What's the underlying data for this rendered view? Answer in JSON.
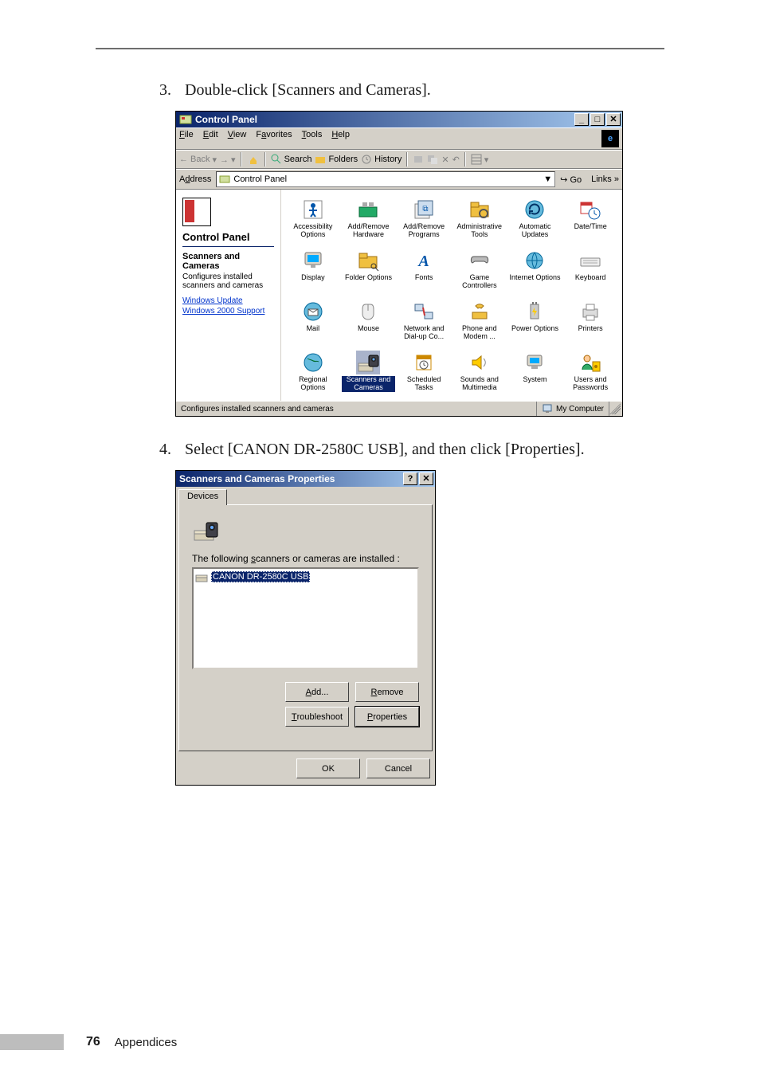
{
  "steps": {
    "s3": {
      "num": "3.",
      "text": "Double-click [Scanners and Cameras]."
    },
    "s4": {
      "num": "4.",
      "text": "Select [CANON DR-2580C USB], and then click [Properties]."
    }
  },
  "control_panel_window": {
    "title": "Control Panel",
    "menus": {
      "file": "File",
      "edit": "Edit",
      "view": "View",
      "favorites": "Favorites",
      "tools": "Tools",
      "help": "Help"
    },
    "toolbar": {
      "back": "Back",
      "search": "Search",
      "folders": "Folders",
      "history": "History"
    },
    "address": {
      "label": "Address",
      "value": "Control Panel",
      "go": "Go",
      "links": "Links"
    },
    "left": {
      "title": "Control Panel",
      "subtitle": "Scanners and Cameras",
      "description": "Configures installed scanners and cameras",
      "links": {
        "wu": "Windows Update",
        "w2k": "Windows 2000 Support"
      }
    },
    "items": [
      {
        "label": "Accessibility Options"
      },
      {
        "label": "Add/Remove Hardware"
      },
      {
        "label": "Add/Remove Programs"
      },
      {
        "label": "Administrative Tools"
      },
      {
        "label": "Automatic Updates"
      },
      {
        "label": "Date/Time"
      },
      {
        "label": "Display"
      },
      {
        "label": "Folder Options"
      },
      {
        "label": "Fonts"
      },
      {
        "label": "Game Controllers"
      },
      {
        "label": "Internet Options"
      },
      {
        "label": "Keyboard"
      },
      {
        "label": "Mail"
      },
      {
        "label": "Mouse"
      },
      {
        "label": "Network and Dial-up Co..."
      },
      {
        "label": "Phone and Modem ..."
      },
      {
        "label": "Power Options"
      },
      {
        "label": "Printers"
      },
      {
        "label": "Regional Options"
      },
      {
        "label": "Scanners and Cameras",
        "selected": true
      },
      {
        "label": "Scheduled Tasks"
      },
      {
        "label": "Sounds and Multimedia"
      },
      {
        "label": "System"
      },
      {
        "label": "Users and Passwords"
      }
    ],
    "statusbar": {
      "text": "Configures installed scanners and cameras",
      "location": "My Computer"
    }
  },
  "properties_dialog": {
    "title": "Scanners and Cameras Properties",
    "tab": "Devices",
    "intro": "The following scanners or cameras are installed :",
    "list_item": "CANON DR-2580C USB",
    "buttons": {
      "add": "Add...",
      "remove": "Remove",
      "troubleshoot": "Troubleshoot",
      "properties": "Properties",
      "ok": "OK",
      "cancel": "Cancel"
    }
  },
  "footer": {
    "page_number": "76",
    "section": "Appendices"
  }
}
